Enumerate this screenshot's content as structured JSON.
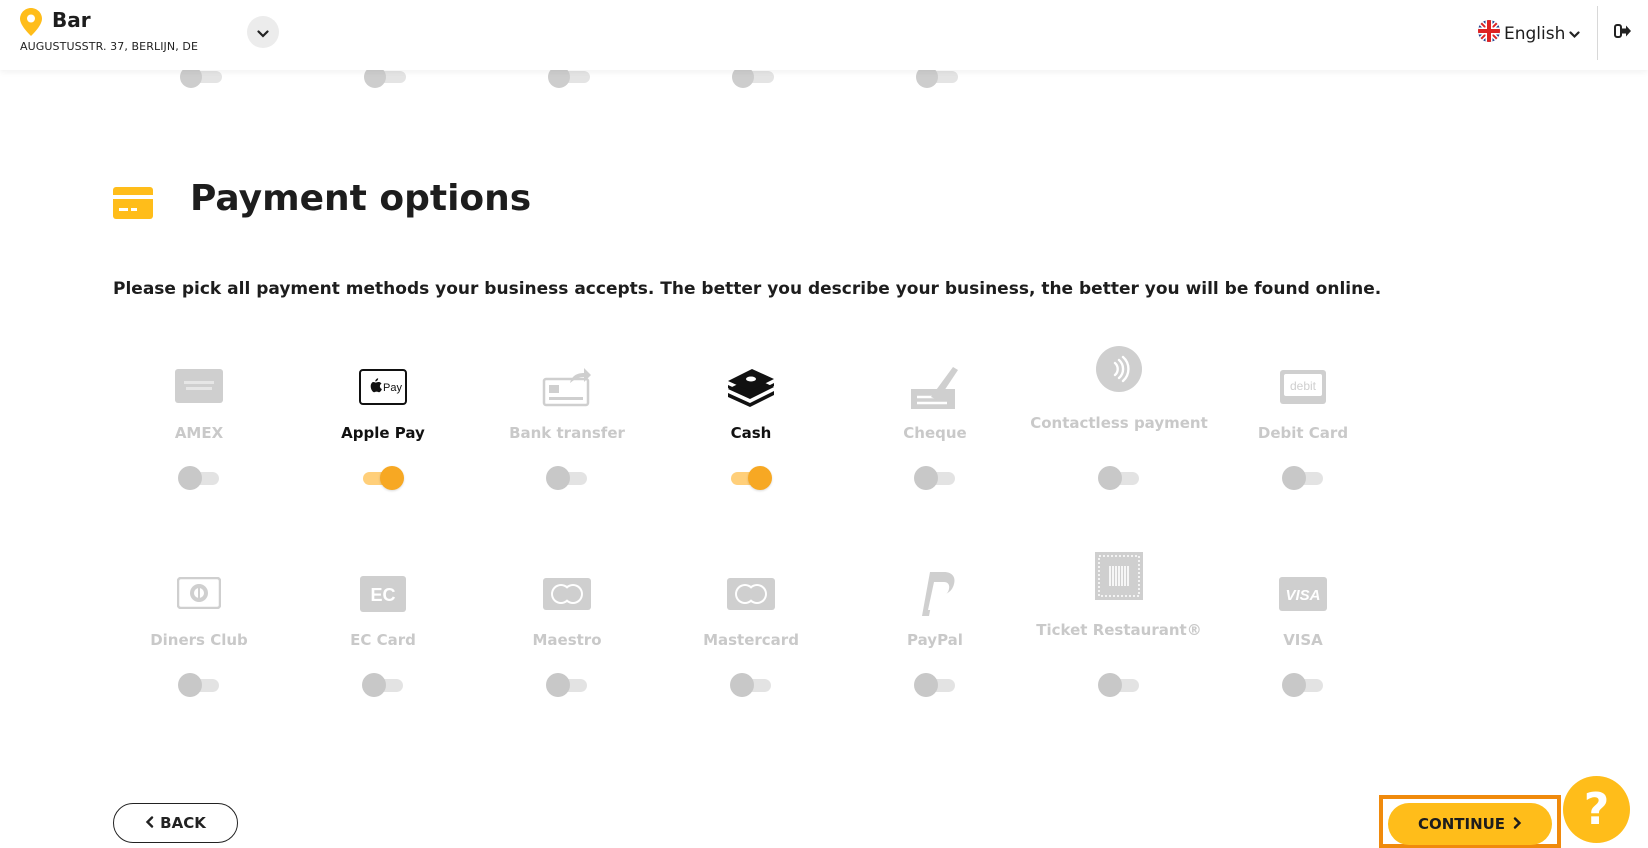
{
  "header": {
    "business_name": "Bar",
    "business_address": "AUGUSTUSSTR. 37, BERLIJN, DE",
    "language": "English"
  },
  "section": {
    "title": "Payment options",
    "instruction": "Please pick all payment methods your business accepts. The better you describe your business, the better you will be found online."
  },
  "payment_methods": [
    {
      "label": "AMEX",
      "icon": "amex-card-icon",
      "enabled": false
    },
    {
      "label": "Apple Pay",
      "icon": "apple-pay-icon",
      "enabled": true
    },
    {
      "label": "Bank transfer",
      "icon": "bank-transfer-icon",
      "enabled": false
    },
    {
      "label": "Cash",
      "icon": "cash-stack-icon",
      "enabled": true
    },
    {
      "label": "Cheque",
      "icon": "cheque-icon",
      "enabled": false
    },
    {
      "label": "Contactless payment",
      "icon": "contactless-icon",
      "enabled": false
    },
    {
      "label": "Debit Card",
      "icon": "debit-card-icon",
      "enabled": false
    },
    {
      "label": "Diners Club",
      "icon": "diners-club-icon",
      "enabled": false
    },
    {
      "label": "EC Card",
      "icon": "ec-card-icon",
      "enabled": false
    },
    {
      "label": "Maestro",
      "icon": "maestro-icon",
      "enabled": false
    },
    {
      "label": "Mastercard",
      "icon": "mastercard-icon",
      "enabled": false
    },
    {
      "label": "PayPal",
      "icon": "paypal-icon",
      "enabled": false
    },
    {
      "label": "Ticket Restaurant®",
      "icon": "ticket-restaurant-icon",
      "enabled": false
    },
    {
      "label": "VISA",
      "icon": "visa-icon",
      "enabled": false
    }
  ],
  "footer": {
    "back_label": "BACK",
    "continue_label": "CONTINUE",
    "help_label": "?"
  },
  "colors": {
    "accent": "#ffbd1a",
    "toggle_on": "#f7a823",
    "highlight_frame": "#f08a0c",
    "inactive_text": "#c9c9c9"
  }
}
